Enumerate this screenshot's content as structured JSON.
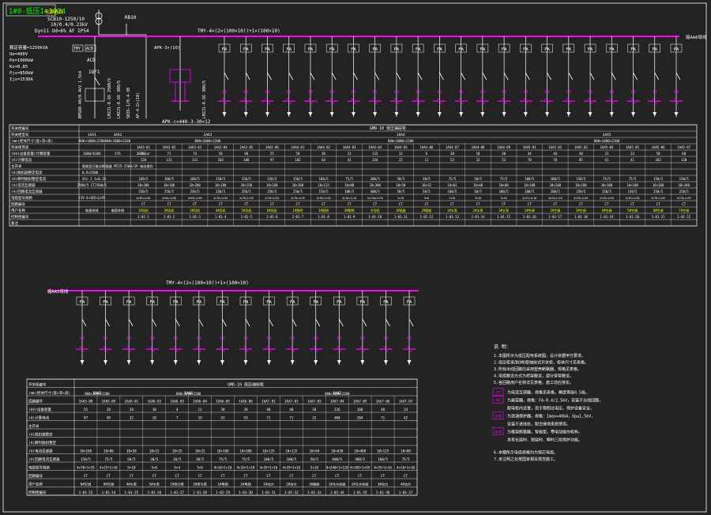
{
  "colors": {
    "background": "#232323",
    "line": "#ffffff",
    "bus": "#ff00ff",
    "text_yellow": "#ffff00",
    "text_green": "#00ff00",
    "frame": "#ffffff"
  },
  "title_block": {
    "label": "1#0-低压I-1024"
  },
  "top": {
    "source_label": "电源进线",
    "transformer_label_1": "SCB10-1250/10",
    "transformer_label_2": "10/0.4/0.23kV",
    "transformer_label_3": "Dyn11 Ud=6% AF IP54",
    "relay_label": "RB10",
    "bus_label": "TMY-4×(2×(100×10))+1×(100×10)",
    "bus_to_right": "接AA6母线",
    "acb_label": "ACB",
    "qf_label": "1QF1",
    "capacitor_label": "APK-c×440-3-30×12",
    "capacitor_label_2": "APK-3×(10)",
    "fa_label": "FA",
    "left_specs": [
      "额定容量=1250kVA",
      "Ue=400V",
      "Pe=1000kW",
      "Kx=0.85",
      "Pjs=850kW",
      "Ijs=1530A"
    ],
    "left_box_labels": [
      "TMY",
      "ACB"
    ],
    "vertical_texts": [
      "BMS80-40/0.4kV 1.5kA",
      "LMZJ1-0.66 2500/5",
      "LMZJ1-0.66 300/5",
      "SKSS-1/0.4-30",
      "AP-4-2×(10)"
    ]
  },
  "top_table": {
    "title": "GMD-10 低压抽屉柜",
    "row_labels": [
      "开关柜编号",
      "开关柜型号",
      "(mm)柜体尺寸(宽×深×高)",
      "开关柜用途",
      "(kV)设备容量/计算容量",
      "(A)计算电流",
      "主开关",
      "(A)脱扣器整定电流",
      "(A)瞬时脱扣整定电流",
      "(A)电流互感器",
      "(A)回路电流互感器",
      "电缆型号规格",
      "回路编号",
      "用户名称",
      "控制柜编号",
      "备注"
    ],
    "groups": [
      "1AA1",
      "1AA2",
      "1AA3",
      "1AA4",
      "1AA5"
    ],
    "group_sizes": [
      "800×1000×2200",
      "800×1000×2200",
      "800×1000×2200",
      "800×1000×2200",
      "800×1000×2200"
    ],
    "group_usage": [
      "1600/6384",
      "576",
      "300kvar"
    ],
    "circuits": [
      "1AA3-01",
      "1AA3-02",
      "1AA3-03",
      "1AA3-04",
      "1AA3-05",
      "1AA3-06",
      "1AA4-01",
      "1AA4-02",
      "1AA4-03",
      "1AA4-04",
      "1AA4-05",
      "1AA4-06",
      "1AA4-07",
      "1AA4-08",
      "1AA4-09",
      "1AA5-01",
      "1AA5-02",
      "1AA5-03",
      "1AA5-04",
      "1AA5-05",
      "1AA5-06",
      "1AA5-07"
    ],
    "capacity": [
      "72",
      "71",
      "74",
      "58",
      "60",
      "55",
      "58",
      "36",
      "23",
      "132",
      "12",
      "6",
      "30",
      "18",
      "30",
      "44",
      "44",
      "48",
      "23",
      "23",
      "58",
      "68"
    ],
    "current": [
      "128",
      "131",
      "131",
      "103",
      "108",
      "97",
      "102",
      "64",
      "41",
      "234",
      "22",
      "11",
      "53",
      "32",
      "53",
      "78",
      "78",
      "85",
      "41",
      "41",
      "102",
      "120"
    ],
    "main_switch_text": "智能型万能式断路器 MT25-2500/3P 电动操作",
    "trip_1": "0.8×2500",
    "trip_2": "4In 1 t=0.25",
    "ct_main": "2500/5 CT2500/5",
    "ct_circuits": [
      "160/5",
      "160/5",
      "160/5",
      "150/5",
      "150/5",
      "150/5",
      "150/5",
      "100/5",
      "75/5",
      "300/5",
      "50/5",
      "30/5",
      "75/5",
      "50/5",
      "75/5",
      "100/5",
      "100/5",
      "150/5",
      "75/5",
      "75/5",
      "150/5",
      "150/5"
    ],
    "breaker": [
      "10×200",
      "10×180",
      "10×200",
      "10×180",
      "10×150",
      "10×160",
      "10×160",
      "10×125",
      "10×80",
      "10×300",
      "10×50",
      "10×32",
      "10×63",
      "10×40",
      "10×80",
      "10×100",
      "10×100",
      "10×160",
      "10×100",
      "10×100",
      "10×160",
      "10×160"
    ],
    "ct_row2": [
      "250/5",
      "250/5",
      "250/5",
      "250/5",
      "250/5",
      "250/5",
      "250/5",
      "150/5",
      "100/5",
      "400/5",
      "50/5",
      "50/5",
      "100/5",
      "50/5",
      "100/5",
      "200/5",
      "200/5",
      "250/5",
      "150/5",
      "150/5",
      "250/5",
      "250/5"
    ],
    "user_row_main": [
      "电源进线",
      "电容补偿"
    ],
    "users": [
      "1#风机",
      "2#风机",
      "3#风机",
      "4#风机",
      "5#风机",
      "6#风机",
      "1#照明",
      "2#照明",
      "3#照明",
      "冷冻机",
      "1#插座",
      "2#插座",
      "1#水泵",
      "2#水泵",
      "3#水泵",
      "1#空调",
      "2#空调",
      "3#空调",
      "4#空调",
      "5#空调",
      "6#空调",
      "7#空调"
    ],
    "cable": "YJV-4×185+1×95",
    "cable_row": [
      "4×95+1×50",
      "4×95+1×50",
      "4×95+1×50",
      "4×70+1×35",
      "4×70+1×35",
      "4×70+1×35",
      "4×70+1×35",
      "4×35+1×16",
      "4×16+1×10",
      "4×150+1×70",
      "5×10",
      "5×6",
      "5×16",
      "5×10",
      "5×16",
      "4×25+1×16",
      "4×25+1×16",
      "4×70+1×35",
      "4×25+1×16",
      "4×25+1×16",
      "4×70+1×35",
      "4×70+1×35"
    ],
    "ct_labels": [
      "CT",
      "CT",
      "CT",
      "CT",
      "CT",
      "CT",
      "CT",
      "CT",
      "CT",
      "CT",
      "CT",
      "CT",
      "CT",
      "CT",
      "CT",
      "CT",
      "CT",
      "CT",
      "CT",
      "CT",
      "CT",
      "CT"
    ],
    "control": [
      "1-01-1",
      "1-01-2",
      "1-01-3",
      "1-01-4",
      "1-01-5",
      "1-01-6",
      "1-01-7",
      "1-01-8",
      "1-01-9",
      "1-01-10",
      "1-01-11",
      "1-01-12",
      "1-01-13",
      "1-01-14",
      "1-01-15",
      "1-01-16",
      "1-01-17",
      "1-01-18",
      "1-01-19",
      "1-01-20",
      "1-01-21",
      "1-01-22"
    ]
  },
  "bottom": {
    "bus_label": "TMY-4×(2×(100×10))+1×(100×10)",
    "bus_from_left": "接AA5母线",
    "fa_label": "FA"
  },
  "bottom_table": {
    "title": "GMD-10 低压抽屉柜",
    "row_labels": [
      "开关柜编号",
      "(mm)柜体尺寸(宽×深×高)",
      "回路编号",
      "(kV)设备容量",
      "(A)计算电流",
      "主开关",
      "(A)脱扣器整定",
      "(A)瞬时脱扣整定",
      "(A)电流互感器",
      "(A)回路电流互感器",
      "电缆型号规格",
      "回路编号",
      "用户名称",
      "控制柜编号",
      "备注"
    ],
    "groups": [
      "1AA5",
      "1AA6",
      "1AA7"
    ],
    "group_sizes": [
      "800×1000×2200",
      "800×1000×2200",
      "800×1000×2200"
    ],
    "circuits": [
      "1AA5-08",
      "1AA5-09",
      "1AA6-01",
      "1AA6-02",
      "1AA6-03",
      "1AA6-04",
      "1AA6-05",
      "1AA6-06",
      "1AA7-01",
      "1AA7-02",
      "1AA7-03",
      "1AA7-04",
      "1AA7-05",
      "1AA7-06",
      "1AA7-07"
    ],
    "capacity": [
      "55",
      "28",
      "18",
      "10",
      "4",
      "11",
      "30",
      "30",
      "40",
      "40",
      "18",
      "226",
      "160",
      "40",
      "24"
    ],
    "current": [
      "97",
      "49",
      "32",
      "18",
      "7",
      "19",
      "53",
      "53",
      "71",
      "71",
      "32",
      "400",
      "284",
      "71",
      "42"
    ],
    "breaker": [
      "10×160",
      "10×80",
      "10×50",
      "10×32",
      "10×25",
      "10×32",
      "10×100",
      "10×100",
      "10×125",
      "10×125",
      "10×50",
      "10×630",
      "10×400",
      "10×125",
      "10×80"
    ],
    "ct": [
      "150/5",
      "75/5",
      "50/5",
      "30/5",
      "20/5",
      "30/5",
      "75/5",
      "75/5",
      "100/5",
      "100/5",
      "50/5",
      "600/5",
      "400/5",
      "100/5",
      "75/5"
    ],
    "cable": [
      "4×70+1×35",
      "4×25+1×16",
      "5×10",
      "5×6",
      "5×4",
      "5×6",
      "4×16+1×10",
      "4×16+1×10",
      "4×35+1×16",
      "4×35+1×16",
      "5×10",
      "4×240+1×120",
      "4×185+1×95",
      "4×35+1×16",
      "4×16+1×10"
    ],
    "ct_labels": [
      "CT",
      "CT",
      "CT",
      "CT",
      "CT",
      "CT",
      "CT",
      "CT",
      "CT",
      "CT",
      "CT",
      "CT",
      "CT",
      "CT",
      "CT"
    ],
    "users": [
      "8#空调",
      "9#空调",
      "4#水泵",
      "5#水泵",
      "1#排污泵",
      "2#排污泵",
      "1#电梯",
      "2#电梯",
      "1#动力",
      "2#动力",
      "3#插座",
      "1#冷水机组",
      "2#冷水机组",
      "3#动力",
      "4#动力"
    ],
    "control": [
      "1-01-23",
      "1-01-24",
      "1-01-25",
      "1-01-26",
      "1-01-27",
      "1-01-28",
      "1-01-29",
      "1-01-30",
      "1-01-31",
      "1-01-32",
      "1-01-33",
      "1-01-34",
      "1-01-35",
      "1-01-36",
      "1-01-37"
    ]
  },
  "notes": {
    "heading": "说 明：",
    "lines": [
      "1.本图所示为低压配电系统图，设计依据甲方要求。",
      "2.低压柜采用GMD型抽屉式开关柜，柜体尺寸见表格。",
      "3.所有出线回路均采用塑壳断路器，规格见表格。",
      "4.电缆敷设方式为桥架敷设，部分穿管敷设。",
      "5.各回路用户名称详见表格，施工前应核实。"
    ],
    "legend": [
      {
        "symbol": "CT",
        "text": "为电流互感器，规格见表格，精度等级0.5级。"
      },
      {
        "symbol": "FA",
        "text": "为避雷器，规格：FA-0.4/2.5kV，安装于出线回路，"
      },
      {
        "symbol": "",
        "text": "配电柜内设置，用于限制过电压，保护设备安全。"
      },
      {
        "symbol": "SPD",
        "text": "为浪涌保护器，规格：Imax=40kA，Up≤1.5kV，"
      },
      {
        "symbol": "",
        "text": "安装于进线处，配合接地系统使用。"
      },
      {
        "symbol": "ACB",
        "text": "为框架断路器，智能型，带电动操作机构，"
      },
      {
        "symbol": "",
        "text": "具有长延时、短延时、瞬时三段保护功能。"
      }
    ],
    "tail_lines": [
      "6.本图所示电缆规格均为铜芯电缆。",
      "7.未注明之处按国家相关规范施工。"
    ]
  }
}
